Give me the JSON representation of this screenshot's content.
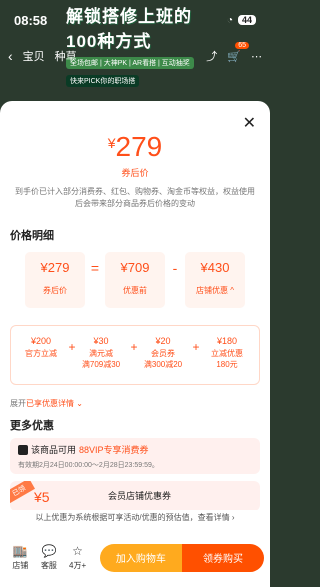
{
  "status": {
    "time": "08:58",
    "battery": "44"
  },
  "banner": {
    "title_line1": "解锁搭修上班的",
    "title_line2": "100种方式",
    "tags": "全场包邮 | 大神PK | AR看搭 | 互动抽奖",
    "sub": "快来PICK你的职场搭"
  },
  "top_nav": {
    "tab1": "宝贝",
    "tab2": "种草",
    "cart_count": "65"
  },
  "sheet": {
    "price_yen": "¥",
    "price_value": "279",
    "price_caption": "券后价",
    "price_note": "到手价已计入部分消费券、红包、购物券、淘金币等权益，权益使用后会带来部分商品券后价格的变动"
  },
  "breakdown": {
    "title": "价格明细",
    "boxes": [
      {
        "value": "¥279",
        "caption": "券后价"
      },
      {
        "value": "¥709",
        "caption": "优惠前"
      },
      {
        "value": "¥430",
        "caption": "店铺优惠"
      }
    ],
    "ops": [
      "=",
      "-"
    ],
    "details": [
      {
        "value": "¥200",
        "label1": "官方立减",
        "label2": ""
      },
      {
        "value": "¥30",
        "label1": "满元减",
        "label2": "满709减30"
      },
      {
        "value": "¥20",
        "label1": "会员券",
        "label2": "满300减20"
      },
      {
        "value": "¥180",
        "label1": "立减优惠",
        "label2": "180元"
      }
    ]
  },
  "expand": {
    "prefix": "展开",
    "highlight": "已享优惠详情",
    "suffix": " ⌄"
  },
  "more": {
    "title": "更多优惠",
    "vip_prefix": "该商品可用",
    "vip_highlight": "88VIP专享消费券",
    "vip_time": "有效期2月24日00:00:00～2月28日23:59:59。",
    "coupon_tag": "已领",
    "coupon_amount": "¥5",
    "coupon_title": "会员店铺优惠券"
  },
  "footnote": "以上优惠为系统根据可享活动/优惠的预估值，查看详情 ›",
  "bottom_bar": {
    "store": "店铺",
    "service": "客服",
    "fav": "4万+",
    "add_cart": "加入购物车",
    "buy": "领券购买"
  },
  "colors": {
    "accent": "#ff4f1a",
    "cart": "#ffaa1e",
    "buy": "#ff5000"
  }
}
